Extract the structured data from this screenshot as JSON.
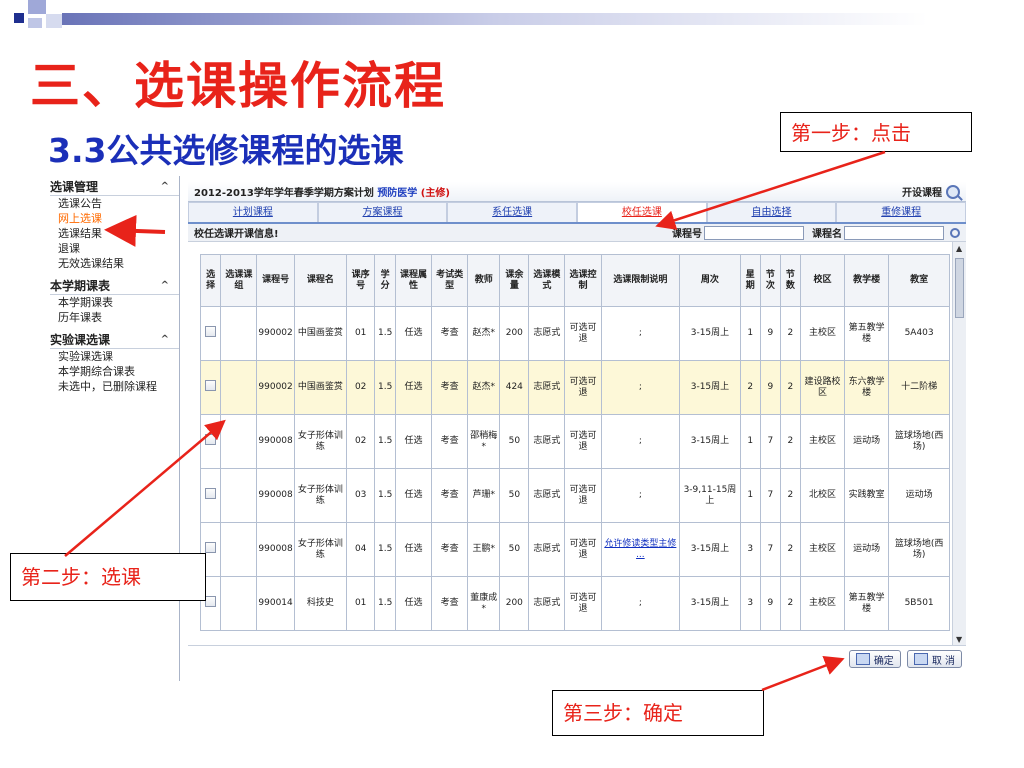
{
  "slide": {
    "title": "三、选课操作流程",
    "subtitle": "3.3公共选修课程的选课"
  },
  "sidebar": {
    "groups": [
      {
        "title": "选课管理",
        "items": [
          "选课公告",
          "网上选课",
          "选课结果",
          "退课",
          "无效选课结果"
        ],
        "active_index": 1
      },
      {
        "title": "本学期课表",
        "items": [
          "本学期课表",
          "历年课表"
        ]
      },
      {
        "title": "实验课选课",
        "items": [
          "实验课选课",
          "本学期综合课表",
          "未选中，已删除课程"
        ]
      }
    ],
    "chevron": "^"
  },
  "app": {
    "plan_title": "2012-2013学年学年春季学期方案计划",
    "major": "预防医学",
    "major_type": "(主修)",
    "open_course_label": "开设课程",
    "tabs": [
      "计划课程",
      "方案课程",
      "系任选课",
      "校任选课",
      "自由选择",
      "重修课程"
    ],
    "active_tab": 3,
    "filter_label": "校任选课开课信息!",
    "course_no_label": "课程号",
    "course_name_label": "课程名",
    "columns": [
      "选择",
      "选课课组",
      "课程号",
      "课程名",
      "课序号",
      "学分",
      "课程属性",
      "考试类型",
      "教师",
      "课余量",
      "选课模式",
      "选课控制",
      "选课限制说明",
      "周次",
      "星期",
      "节次",
      "节数",
      "校区",
      "教学楼",
      "教室"
    ],
    "rows": [
      {
        "course_no": "990002",
        "name": "中国画鉴赏",
        "seq": "01",
        "credit": "1.5",
        "attr": "任选",
        "exam": "考查",
        "teacher": "赵杰*",
        "remain": "200",
        "mode": "志愿式",
        "control": "可选可退",
        "limit": ";",
        "weeks": "3-15周上",
        "weekday": "1",
        "section": "9",
        "count": "2",
        "campus": "主校区",
        "building": "第五教学楼",
        "room": "5A403",
        "highlight": false
      },
      {
        "course_no": "990002",
        "name": "中国画鉴赏",
        "seq": "02",
        "credit": "1.5",
        "attr": "任选",
        "exam": "考查",
        "teacher": "赵杰*",
        "remain": "424",
        "mode": "志愿式",
        "control": "可选可退",
        "limit": ";",
        "weeks": "3-15周上",
        "weekday": "2",
        "section": "9",
        "count": "2",
        "campus": "建设路校区",
        "building": "东六教学楼",
        "room": "十二阶梯",
        "highlight": true
      },
      {
        "course_no": "990008",
        "name": "女子形体训练",
        "seq": "02",
        "credit": "1.5",
        "attr": "任选",
        "exam": "考查",
        "teacher": "邵稍梅*",
        "remain": "50",
        "mode": "志愿式",
        "control": "可选可退",
        "limit": ";",
        "weeks": "3-15周上",
        "weekday": "1",
        "section": "7",
        "count": "2",
        "campus": "主校区",
        "building": "运动场",
        "room": "篮球场地(西场)",
        "highlight": false
      },
      {
        "course_no": "990008",
        "name": "女子形体训练",
        "seq": "03",
        "credit": "1.5",
        "attr": "任选",
        "exam": "考查",
        "teacher": "芦珊*",
        "remain": "50",
        "mode": "志愿式",
        "control": "可选可退",
        "limit": ";",
        "weeks": "3-9,11-15周上",
        "weekday": "1",
        "section": "7",
        "count": "2",
        "campus": "北校区",
        "building": "实践教室",
        "room": "运动场",
        "highlight": false
      },
      {
        "course_no": "990008",
        "name": "女子形体训练",
        "seq": "04",
        "credit": "1.5",
        "attr": "任选",
        "exam": "考查",
        "teacher": "王鹏*",
        "remain": "50",
        "mode": "志愿式",
        "control": "可选可退",
        "limit": "允许修读类型主修 ...",
        "weeks": "3-15周上",
        "weekday": "3",
        "section": "7",
        "count": "2",
        "campus": "主校区",
        "building": "运动场",
        "room": "篮球场地(西场)",
        "highlight": false
      },
      {
        "course_no": "990014",
        "name": "科技史",
        "seq": "01",
        "credit": "1.5",
        "attr": "任选",
        "exam": "考查",
        "teacher": "董康成*",
        "remain": "200",
        "mode": "志愿式",
        "control": "可选可退",
        "limit": ";",
        "weeks": "3-15周上",
        "weekday": "3",
        "section": "9",
        "count": "2",
        "campus": "主校区",
        "building": "第五教学楼",
        "room": "5B501",
        "highlight": false
      }
    ],
    "confirm_label": "确定",
    "cancel_label": "取 消"
  },
  "callouts": {
    "step1": "第一步：点击",
    "step2": "第二步：选课",
    "step3": "第三步：确定"
  },
  "colors": {
    "accent_red": "#e8231a",
    "title_blue": "#1b2fb8",
    "highlight_row": "#fdf8d8"
  }
}
